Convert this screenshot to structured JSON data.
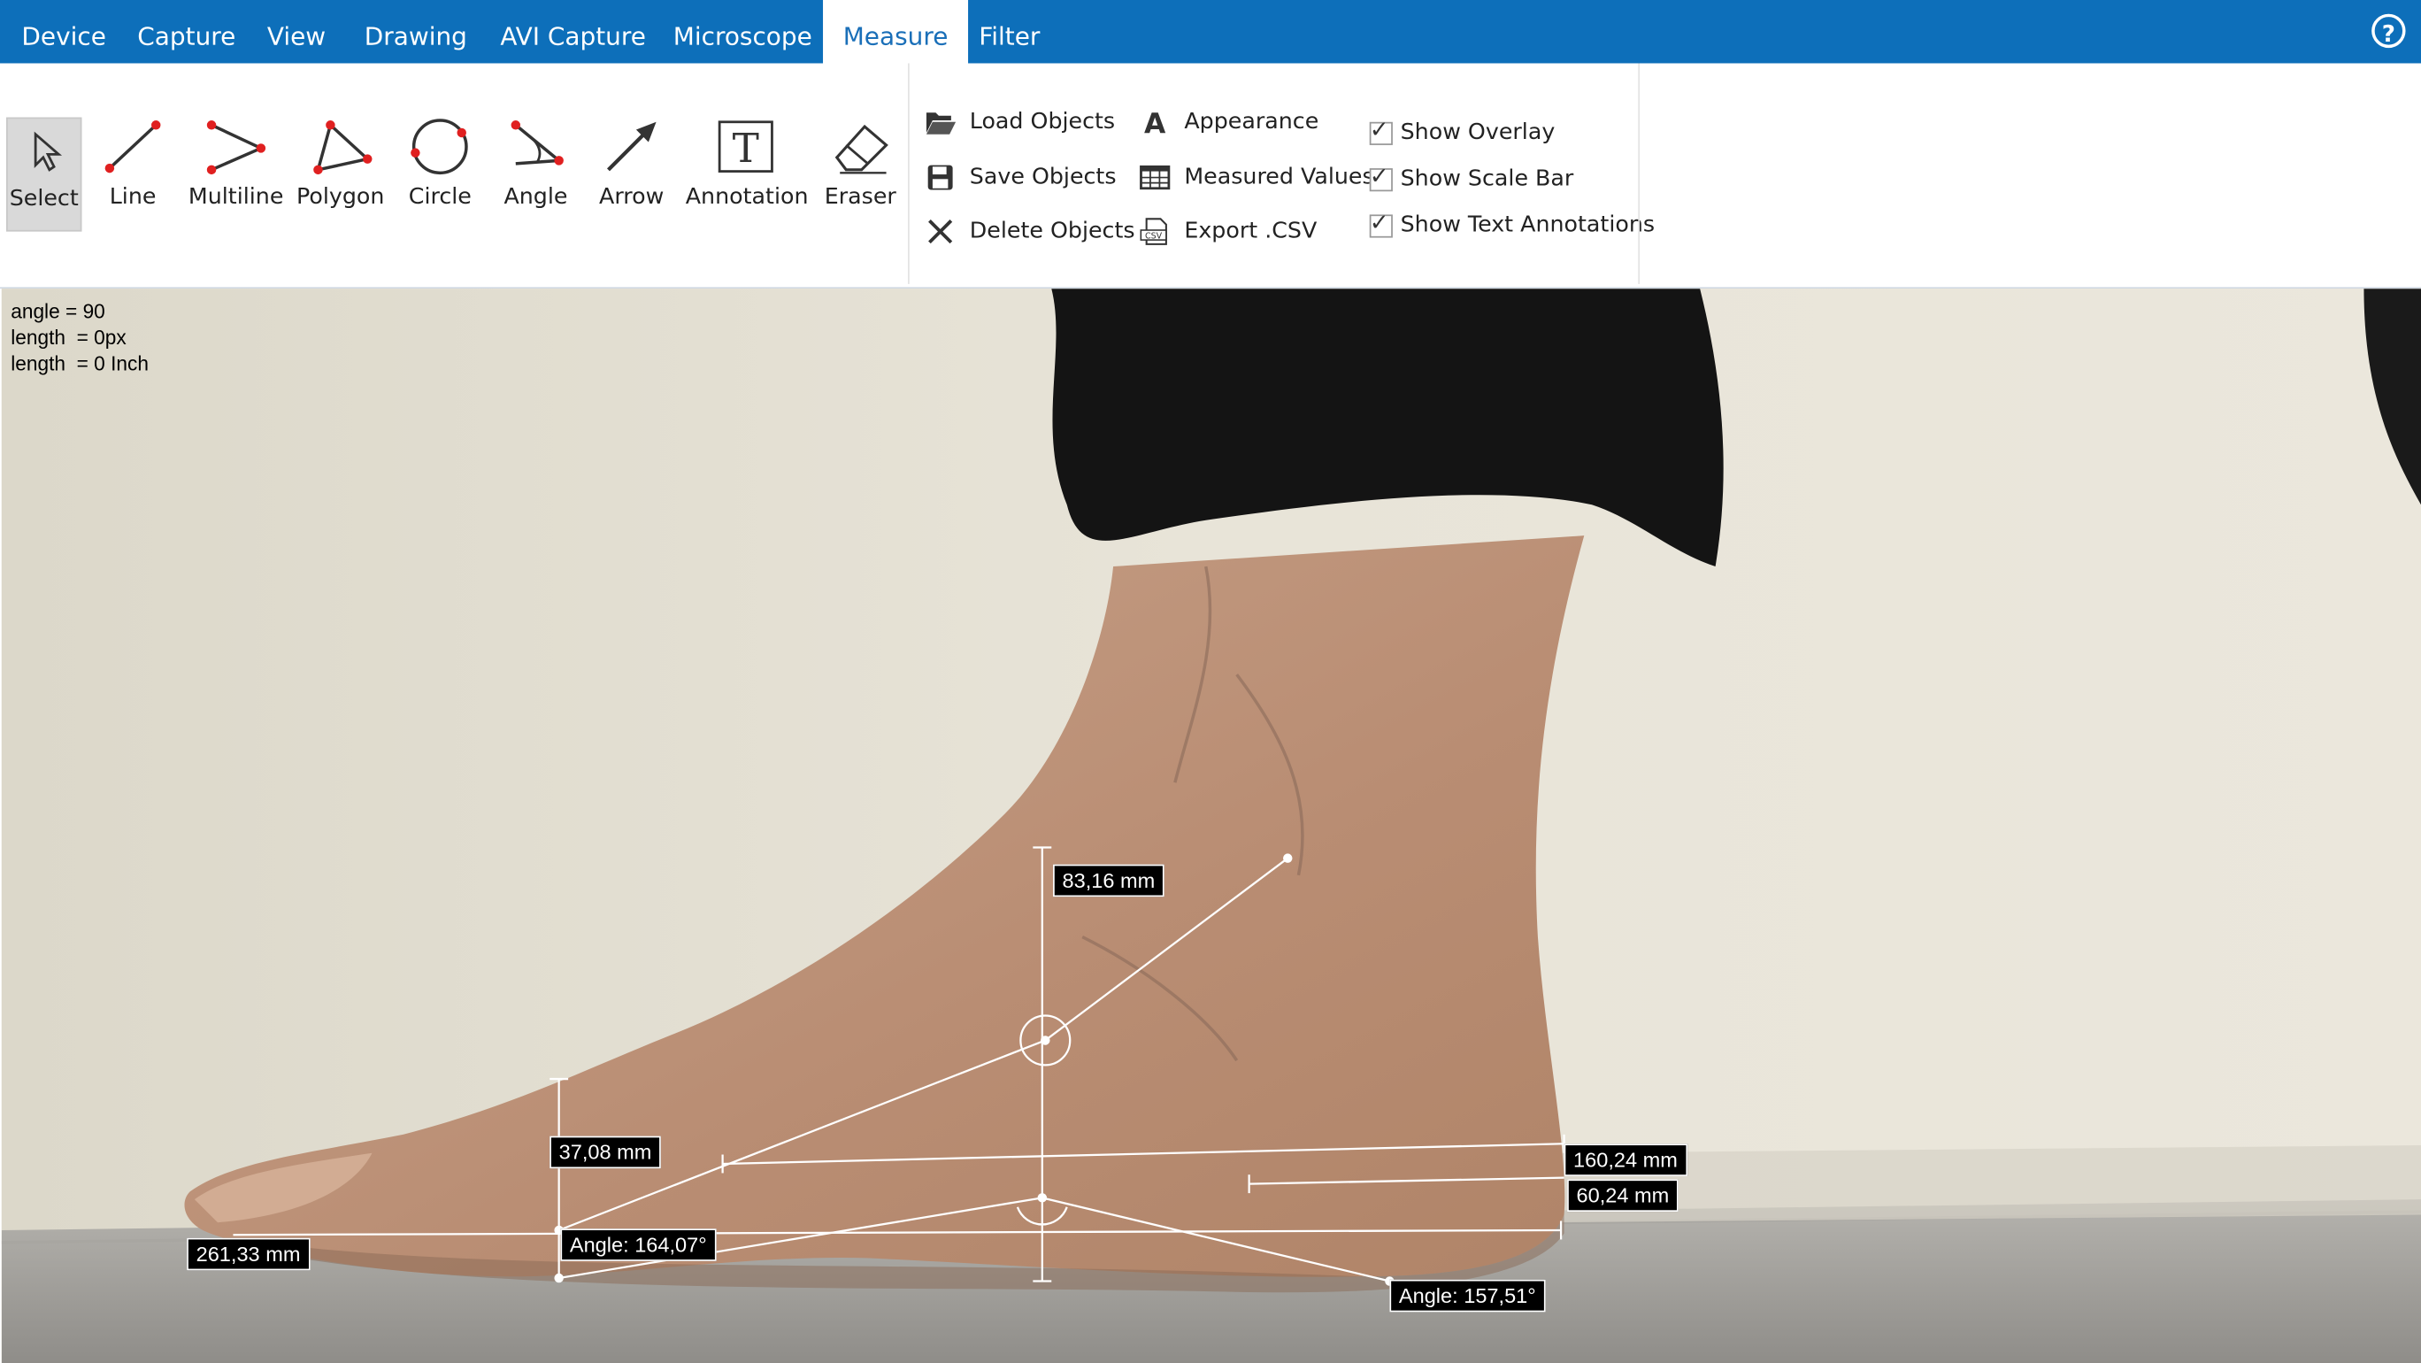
{
  "menu": {
    "items": [
      "Device",
      "Capture",
      "View",
      "Drawing",
      "AVI Capture",
      "Microscope",
      "Measure",
      "Filter"
    ],
    "active": "Measure"
  },
  "tools": [
    {
      "label": "Select",
      "icon": "cursor-icon"
    },
    {
      "label": "Line",
      "icon": "line-icon"
    },
    {
      "label": "Multiline",
      "icon": "multiline-icon"
    },
    {
      "label": "Polygon",
      "icon": "polygon-icon"
    },
    {
      "label": "Circle",
      "icon": "circle-icon"
    },
    {
      "label": "Angle",
      "icon": "angle-icon"
    },
    {
      "label": "Arrow",
      "icon": "arrow-icon"
    },
    {
      "label": "Annotation",
      "icon": "text-icon"
    },
    {
      "label": "Eraser",
      "icon": "eraser-icon"
    }
  ],
  "objects": {
    "load": "Load Objects",
    "save": "Save Objects",
    "delete": "Delete Objects"
  },
  "values": {
    "appearance": "Appearance",
    "measured": "Measured Values",
    "export": "Export .CSV"
  },
  "options": {
    "overlay": {
      "label": "Show Overlay",
      "checked": true
    },
    "scalebar": {
      "label": "Show Scale Bar",
      "checked": true
    },
    "textann": {
      "label": "Show Text Annotations",
      "checked": true
    }
  },
  "readout": {
    "angle": "angle = 90",
    "length_px": "length  = 0px",
    "length_inch": "length  = 0 Inch"
  },
  "measurements": {
    "height_top": "83,16 mm",
    "height_arch": "37,08 mm",
    "length_total": "261,33 mm",
    "length_1": "160,24 mm",
    "length_2": "60,24 mm",
    "angle_1": "Angle: 164,07°",
    "angle_2": "Angle: 157,51°"
  },
  "colors": {
    "menubar": "#0d6fba",
    "accent_red": "#e02020",
    "overlay": "#ffffff"
  }
}
